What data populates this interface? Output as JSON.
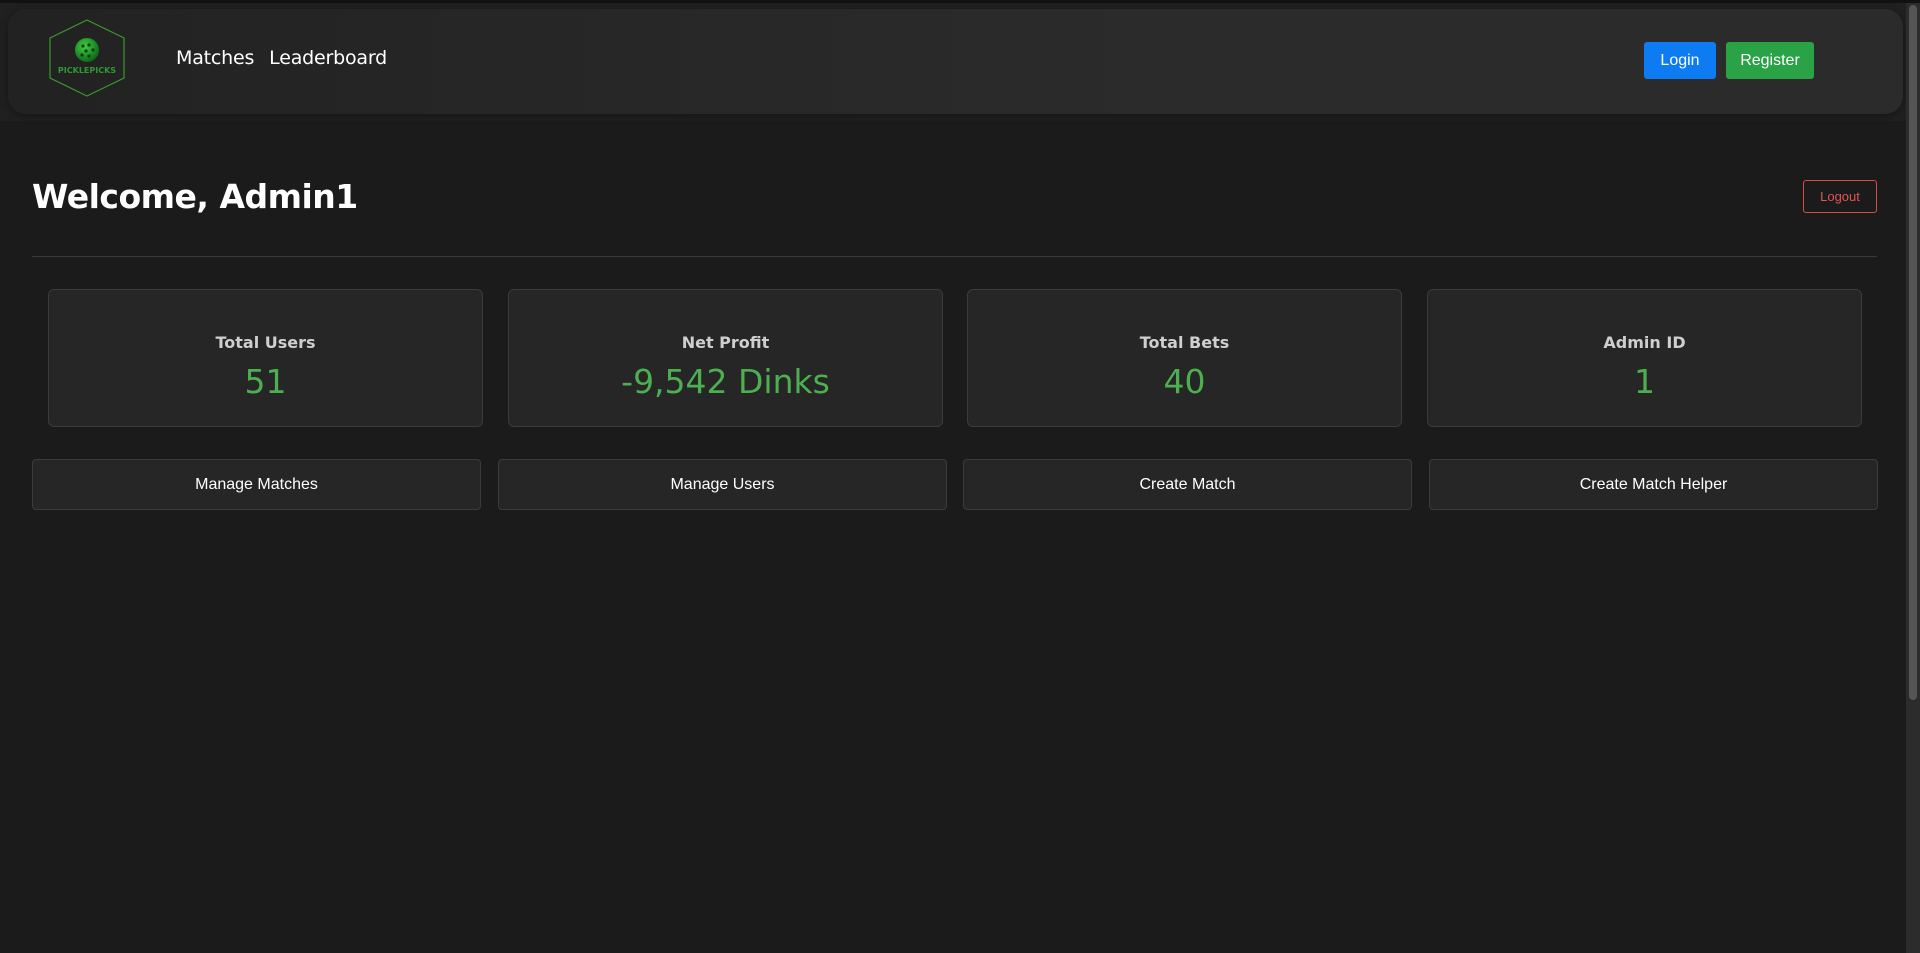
{
  "brand": {
    "logo_text": "PICKLEPICKS"
  },
  "nav": {
    "links": [
      "Matches",
      "Leaderboard"
    ],
    "login_label": "Login",
    "register_label": "Register"
  },
  "dashboard": {
    "welcome": "Welcome, Admin1",
    "logout_label": "Logout",
    "stats": [
      {
        "label": "Total Users",
        "value": "51"
      },
      {
        "label": "Net Profit",
        "value": "-9,542 Dinks"
      },
      {
        "label": "Total Bets",
        "value": "40"
      },
      {
        "label": "Admin ID",
        "value": "1"
      }
    ],
    "actions": [
      "Manage Matches",
      "Manage Users",
      "Create Match",
      "Create Match Helper"
    ]
  },
  "colors": {
    "background": "#1b1b1b",
    "accent_green": "#4caf50",
    "login_blue": "#0d7cf2",
    "register_green": "#2aa246",
    "logout_red": "#d84a4a"
  }
}
